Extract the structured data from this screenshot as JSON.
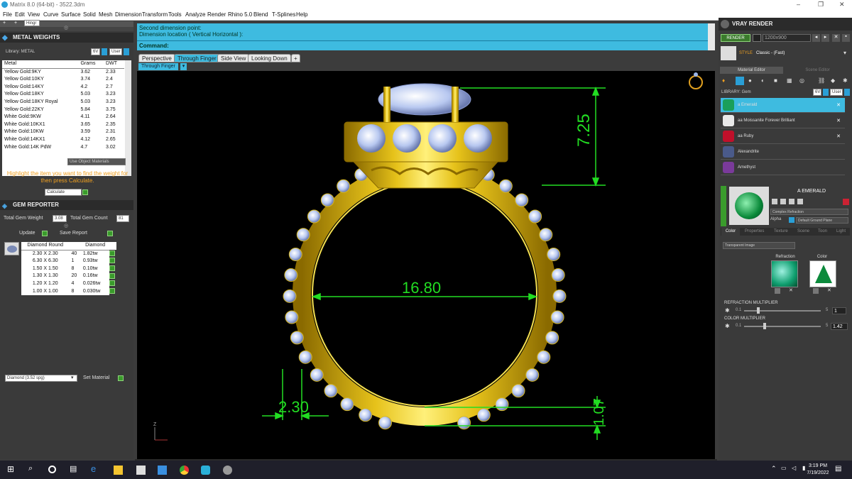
{
  "window": {
    "title": "Matrix 8.0 (64-bit) - 3522.3dm"
  },
  "menu": [
    "File",
    "Edit",
    "View",
    "Curve",
    "Surface",
    "Solid",
    "Mesh",
    "Dimension",
    "Transform",
    "Tools",
    "Analyze",
    "Render",
    "Rhino 5.0",
    "Blend",
    "T-Splines",
    "Help"
  ],
  "toolbar_left": {
    "field": "Hingr"
  },
  "metal_weights": {
    "title": "METAL WEIGHTS",
    "library_label": "Library: METAL",
    "btn_user": "User",
    "headers": [
      "Metal",
      "Grams",
      "DWT"
    ],
    "rows": [
      [
        "Yellow Gold:9KY",
        "3.62",
        "2.33"
      ],
      [
        "Yellow Gold:10KY",
        "3.74",
        "2.4"
      ],
      [
        "Yellow Gold:14KY",
        "4.2",
        "2.7"
      ],
      [
        "Yellow Gold:18KY",
        "5.03",
        "3.23"
      ],
      [
        "Yellow Gold:18KY Royal",
        "5.03",
        "3.23"
      ],
      [
        "Yellow Gold:22KY",
        "5.84",
        "3.75"
      ],
      [
        "White Gold:9KW",
        "4.11",
        "2.64"
      ],
      [
        "White Gold:10KX1",
        "3.65",
        "2.35"
      ],
      [
        "White Gold:10KW",
        "3.59",
        "2.31"
      ],
      [
        "White Gold:14KX1",
        "4.12",
        "2.65"
      ],
      [
        "White Gold:14K PdW",
        "4.7",
        "3.02"
      ]
    ],
    "use_object_materials": "Use Object Materials",
    "instruction": "Highlight the item you want to find the weight for then press Calculate.",
    "calculate": "Calculate"
  },
  "gem_reporter": {
    "title": "GEM REPORTER",
    "total_gem_weight_label": "Total Gem Weight",
    "total_gem_weight": "3.08",
    "total_gem_count_label": "Total Gem Count",
    "total_gem_count": "81",
    "update": "Update",
    "save_report": "Save Report",
    "headers": [
      "Diamond Round",
      "",
      "Diamond"
    ],
    "rows": [
      [
        "2.30 X 2.30",
        "40",
        "1.82tw"
      ],
      [
        "6.30 X 6.30",
        "1",
        "0.93tw"
      ],
      [
        "1.50 X 1.50",
        "8",
        "0.10tw"
      ],
      [
        "1.30 X 1.30",
        "20",
        "0.16tw"
      ],
      [
        "1.20 X 1.20",
        "4",
        "0.026tw"
      ],
      [
        "1.00 X 1.00",
        "8",
        "0.030tw"
      ]
    ],
    "material_select": "Diamond    (3.52 spg)",
    "set_material": "Set Material"
  },
  "command": {
    "line1": "Second dimension point:",
    "line2": "Dimension location ( Vertical  Horizontal ):",
    "prompt": "Command:"
  },
  "view_tabs": [
    "Perspective",
    "Through Finger",
    "Side View",
    "Looking Down"
  ],
  "active_view": "Through Finger",
  "viewport": {
    "dim_top": "7.25",
    "dim_inner": "16.80",
    "dim_shank": "2.30",
    "dim_bottom": "1.07",
    "axis_z": "Z"
  },
  "vray": {
    "title": "VRAY RENDER",
    "render_btn": "RENDER",
    "resolution": "1200x900",
    "btn_user": "User",
    "style_label": "STYLE",
    "style_value": "Classic - (Fast)",
    "material_editor_tab": "Material Editor",
    "scene_editor_tab": "Scene Editor",
    "library_label": "LIBRARY: Gem",
    "materials": [
      {
        "name": "a Emerald",
        "color": "#1a9f5a"
      },
      {
        "name": "aa Moissanite Forever Brilliant",
        "color": "#e9e9e9"
      },
      {
        "name": "aa Ruby",
        "color": "#c0102a"
      },
      {
        "name": "Alexandrite",
        "color": "#4a5a8a"
      },
      {
        "name": "Amethyst",
        "color": "#7a3a9a"
      }
    ],
    "selected_name": "A EMERALD",
    "material_type": "Complex Refraction",
    "alpha_label": "Alpha",
    "ground_plane": "Default Ground Plane",
    "sub_tabs": [
      "Color",
      "Properties",
      "Texture",
      "Scene",
      "Toon",
      "Light"
    ],
    "transparent_image": "Transparent Image",
    "refraction_label": "Refraction",
    "color_label": "Color",
    "refraction_multiplier_label": "REFRACTION MULTIPLIER",
    "refraction_min": "0.1",
    "refraction_max": "5",
    "refraction_value": "1",
    "color_multiplier_label": "COLOR MULTIPLIER",
    "color_min": "0.1",
    "color_max": "5",
    "color_value": "1.42"
  },
  "taskbar": {
    "time": "3:19 PM",
    "date": "7/19/2022"
  }
}
